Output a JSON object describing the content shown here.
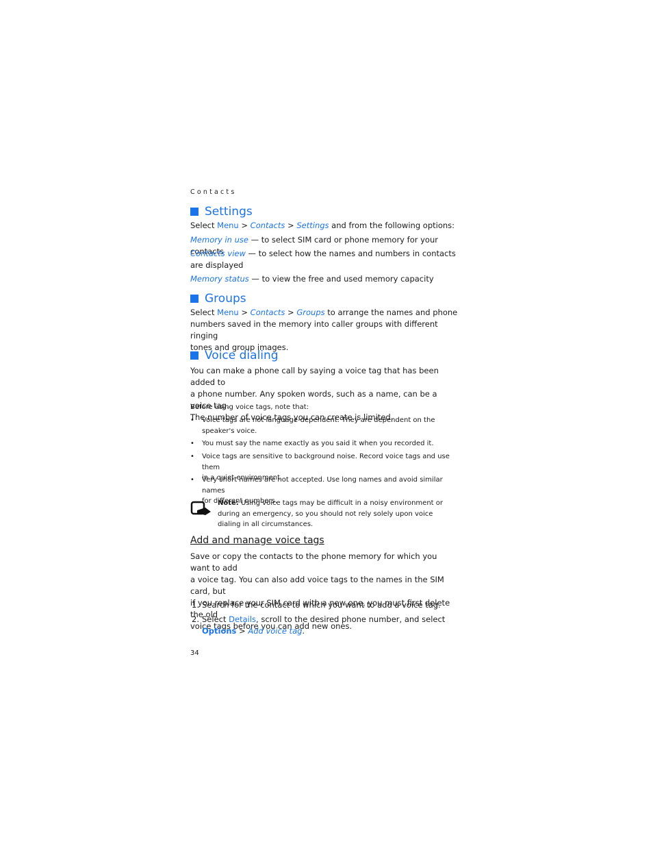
{
  "running_head": "Contacts",
  "page_number": "34",
  "accent_color": "#1a73e8",
  "settings": {
    "heading": "Settings",
    "intro": {
      "t1": "Select ",
      "menu": "Menu",
      "sep1": " > ",
      "contacts": "Contacts",
      "sep2": " > ",
      "settings": "Settings",
      "t2": " and from the following options:"
    },
    "options": [
      {
        "label": "Memory in use",
        "desc": " — to select SIM card or phone memory for your contacts"
      },
      {
        "label": "Contacts view",
        "desc": " — to select how the names and numbers in contacts",
        "desc2": "are displayed"
      },
      {
        "label": "Memory status",
        "desc": " — to view the free and used memory capacity"
      }
    ]
  },
  "groups": {
    "heading": "Groups",
    "t1": "Select ",
    "menu": "Menu",
    "sep1": " > ",
    "contacts": "Contacts",
    "sep2": " > ",
    "groups": "Groups",
    "line1": " to arrange the names and phone",
    "line2": "numbers saved in the memory into caller groups with different ringing",
    "line3": "tones and group images."
  },
  "voice_dialing": {
    "heading": "Voice dialing",
    "para": [
      "You can make a phone call by saying a voice tag that has been added to",
      "a phone number. Any spoken words, such as a name, can be a voice tag.",
      "The number of voice tags you can create is limited."
    ],
    "before": "Before using voice tags, note that:",
    "bullets": [
      [
        "Voice tags are not language-dependent. They are dependent on the",
        "speaker's voice."
      ],
      [
        "You must say the name exactly as you said it when you recorded it."
      ],
      [
        "Voice tags are sensitive to background noise. Record voice tags and use them",
        "in a quiet environment."
      ],
      [
        "Very short names are not accepted. Use long names and avoid similar names",
        "for different numbers."
      ]
    ],
    "bullet_char": "•",
    "note": {
      "label": "Note:",
      "lines": [
        " Using voice tags may be difficult in a noisy environment or",
        "during an emergency, so you should not rely solely upon voice",
        "dialing in all circumstances."
      ]
    }
  },
  "add_manage": {
    "heading": "Add and manage voice tags",
    "para": [
      "Save or copy the contacts to the phone memory for which you want to add",
      "a voice tag. You can also add voice tags to the names in the SIM card, but",
      "if you replace your SIM card with a new one, you must first delete the old",
      "voice tags before you can add new ones."
    ],
    "steps": [
      {
        "n": "1.",
        "text": "Search for the contact to which you want to add a voice tag."
      },
      {
        "n": "2.",
        "t1": "Select ",
        "details": "Details",
        "t2": ", scroll to the desired phone number, and select",
        "options": "Options",
        "sep": " > ",
        "add": "Add voice tag",
        "end": "."
      }
    ]
  }
}
